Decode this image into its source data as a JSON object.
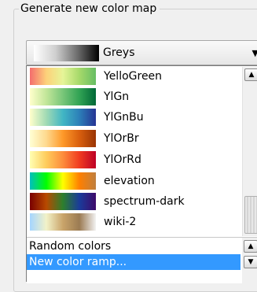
{
  "group": {
    "title": "Generate new color map"
  },
  "combo": {
    "value": "Greys",
    "arrow_icon": "dropdown-arrow-icon",
    "swatch_colors": [
      "#ffffff",
      "#cfcfcf",
      "#6e6e6e",
      "#000000"
    ]
  },
  "ramps": [
    {
      "label": "YelloGreen",
      "colors": [
        "#f46d6d",
        "#fdd17a",
        "#e6f598",
        "#a6d96a",
        "#66bd63"
      ]
    },
    {
      "label": "YlGn",
      "colors": [
        "#ffffcc",
        "#c2e699",
        "#78c679",
        "#31a354",
        "#006837"
      ]
    },
    {
      "label": "YlGnBu",
      "colors": [
        "#ffffcc",
        "#a1dab4",
        "#41b6c4",
        "#2c7fb8",
        "#253494"
      ]
    },
    {
      "label": "YlOrBr",
      "colors": [
        "#ffffd4",
        "#fed98e",
        "#fe9929",
        "#d95f0e",
        "#993404"
      ]
    },
    {
      "label": "YlOrRd",
      "colors": [
        "#ffffb2",
        "#fecc5c",
        "#fd8d3c",
        "#f03b20",
        "#bd0026"
      ]
    },
    {
      "label": "elevation",
      "colors": [
        "#00bfbf",
        "#00ff00",
        "#ffff00",
        "#ff7f00",
        "#bf7f3f"
      ]
    },
    {
      "label": "spectrum-dark",
      "colors": [
        "#7a0000",
        "#b84a00",
        "#2d7f2d",
        "#1a3b9a",
        "#3d0a6a"
      ]
    },
    {
      "label": "wiki-2",
      "colors": [
        "#a5d5ff",
        "#f2f2c8",
        "#c9a46a",
        "#9b7b53",
        "#f2f2f2"
      ]
    }
  ],
  "lower_items": {
    "random": "Random colors",
    "new_ramp": "New color ramp..."
  },
  "scrollbar": {
    "up_icon": "scroll-up-arrow-icon",
    "down_icon": "scroll-down-arrow-icon"
  },
  "colors": {
    "selection": "#3399ff",
    "border": "#7a7a7a"
  }
}
